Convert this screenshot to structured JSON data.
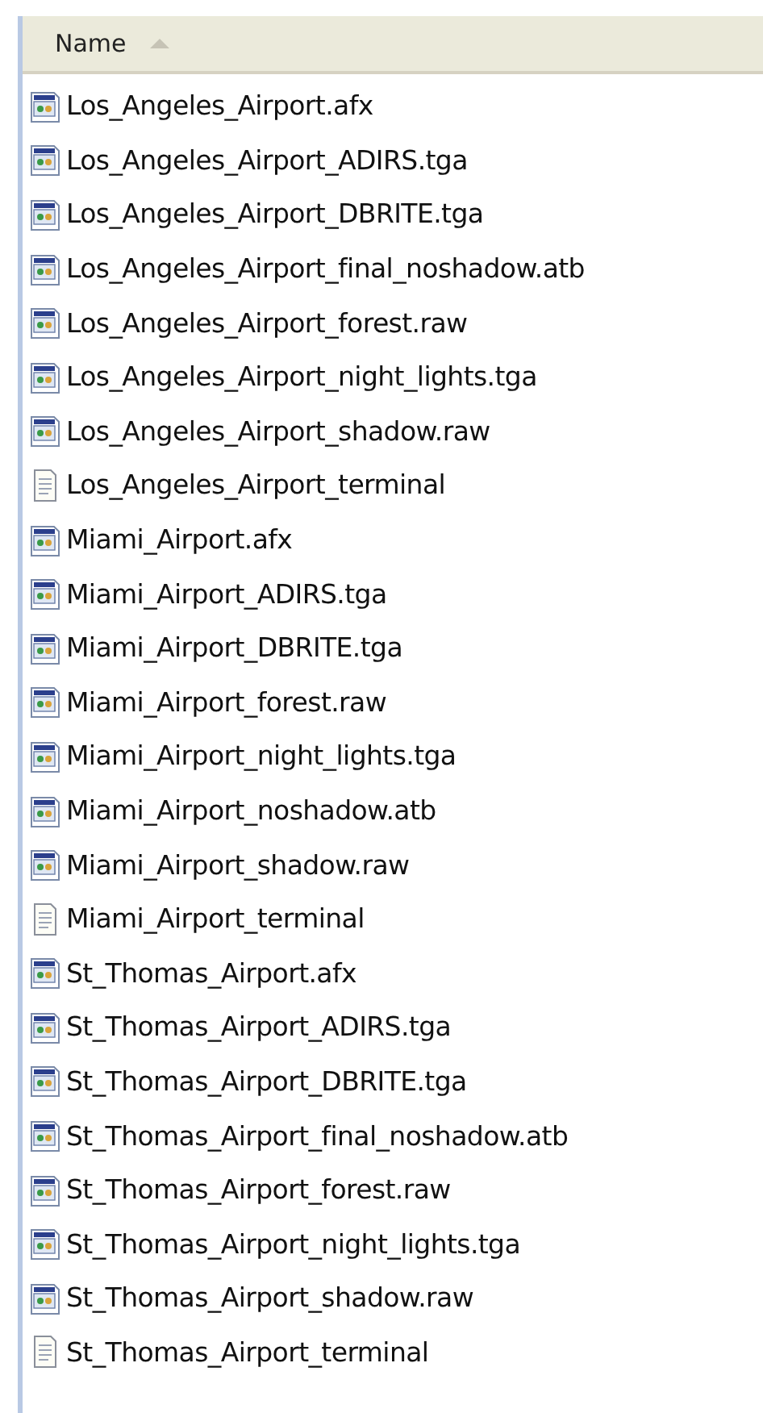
{
  "header": {
    "label": "Name"
  },
  "files": [
    {
      "name": "Los_Angeles_Airport.afx",
      "kind": "file"
    },
    {
      "name": "Los_Angeles_Airport_ADIRS.tga",
      "kind": "file"
    },
    {
      "name": "Los_Angeles_Airport_DBRITE.tga",
      "kind": "file"
    },
    {
      "name": "Los_Angeles_Airport_final_noshadow.atb",
      "kind": "file"
    },
    {
      "name": "Los_Angeles_Airport_forest.raw",
      "kind": "file"
    },
    {
      "name": "Los_Angeles_Airport_night_lights.tga",
      "kind": "file"
    },
    {
      "name": "Los_Angeles_Airport_shadow.raw",
      "kind": "file"
    },
    {
      "name": "Los_Angeles_Airport_terminal",
      "kind": "text"
    },
    {
      "name": "Miami_Airport.afx",
      "kind": "file"
    },
    {
      "name": "Miami_Airport_ADIRS.tga",
      "kind": "file"
    },
    {
      "name": "Miami_Airport_DBRITE.tga",
      "kind": "file"
    },
    {
      "name": "Miami_Airport_forest.raw",
      "kind": "file"
    },
    {
      "name": "Miami_Airport_night_lights.tga",
      "kind": "file"
    },
    {
      "name": "Miami_Airport_noshadow.atb",
      "kind": "file"
    },
    {
      "name": "Miami_Airport_shadow.raw",
      "kind": "file"
    },
    {
      "name": "Miami_Airport_terminal",
      "kind": "text"
    },
    {
      "name": "St_Thomas_Airport.afx",
      "kind": "file"
    },
    {
      "name": "St_Thomas_Airport_ADIRS.tga",
      "kind": "file"
    },
    {
      "name": "St_Thomas_Airport_DBRITE.tga",
      "kind": "file"
    },
    {
      "name": "St_Thomas_Airport_final_noshadow.atb",
      "kind": "file"
    },
    {
      "name": "St_Thomas_Airport_forest.raw",
      "kind": "file"
    },
    {
      "name": "St_Thomas_Airport_night_lights.tga",
      "kind": "file"
    },
    {
      "name": "St_Thomas_Airport_shadow.raw",
      "kind": "file"
    },
    {
      "name": "St_Thomas_Airport_terminal",
      "kind": "text"
    }
  ]
}
